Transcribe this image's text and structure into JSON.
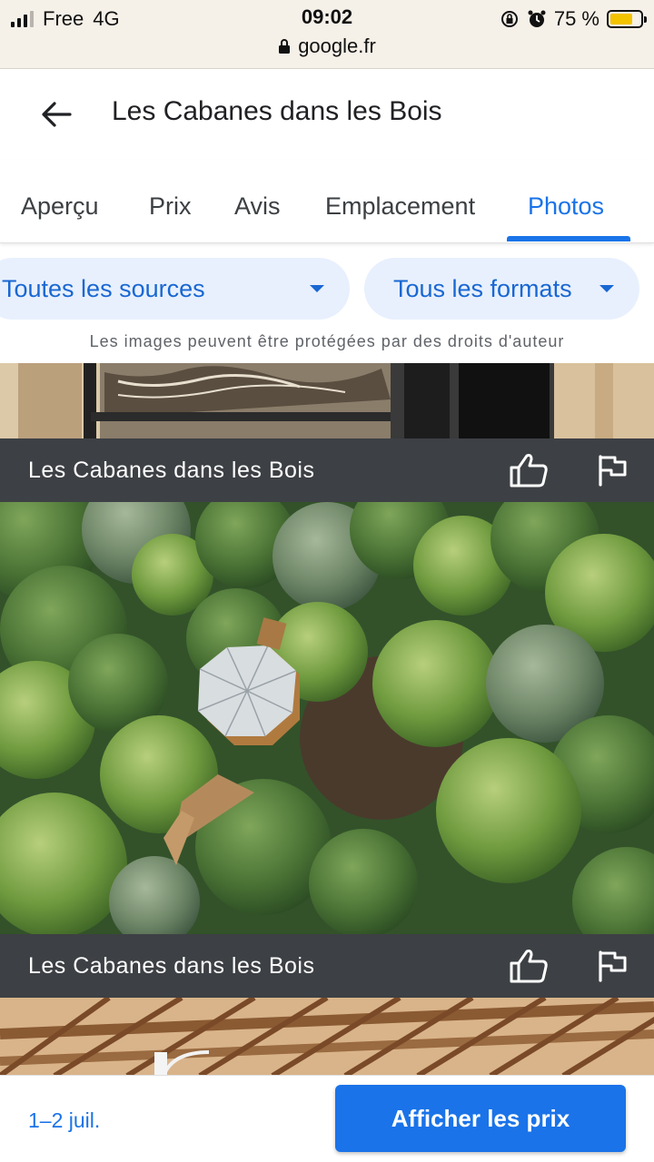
{
  "status_bar": {
    "carrier": "Free",
    "network": "4G",
    "time": "09:02",
    "url": "google.fr",
    "battery_percent": "75 %",
    "battery_level": 0.75
  },
  "header": {
    "title": "Les Cabanes dans les Bois"
  },
  "tabs": [
    {
      "label": "Aperçu"
    },
    {
      "label": "Prix"
    },
    {
      "label": "Avis"
    },
    {
      "label": "Emplacement"
    },
    {
      "label": "Photos",
      "active": true
    }
  ],
  "filters": {
    "source": "Toutes les sources",
    "format": "Tous les formats"
  },
  "copyright_notice": "Les images peuvent être protégées par des droits d'auteur",
  "photos": [
    {
      "caption": "Les Cabanes dans les Bois"
    },
    {
      "caption": "Les Cabanes dans les Bois"
    }
  ],
  "footer": {
    "dates": "1–2 juil.",
    "cta": "Afficher les prix"
  },
  "colors": {
    "accent": "#1a73e8",
    "chip_bg": "#e8f0fe",
    "caption_bg": "#3d4044",
    "battery": "#f3c300"
  }
}
